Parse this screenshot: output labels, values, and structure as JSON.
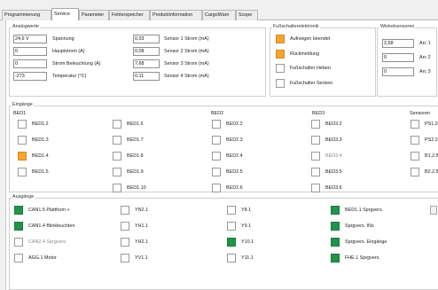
{
  "tabs": [
    "Programmierung",
    "Service",
    "Parameter",
    "Fehlerspeicher",
    "Produktinformation",
    "CargoWarn",
    "Scope"
  ],
  "active_tab": "Service",
  "analogwerte": {
    "title": "Analogwerte",
    "left": [
      {
        "value": "24,6 V",
        "label": "Spannung"
      },
      {
        "value": "0",
        "label": "Hauptstrom (A)"
      },
      {
        "value": "0",
        "label": "Strom Beleuchtung (A)"
      },
      {
        "value": "-273",
        "label": "Temperatur (°C)"
      }
    ],
    "right": [
      {
        "value": "0,03",
        "label": "Sensor 1 Strom (mA)"
      },
      {
        "value": "0,08",
        "label": "Sensor 2 Strom (mA)"
      },
      {
        "value": "7,68",
        "label": "Sensor 3 Strom (mA)"
      },
      {
        "value": "0,11",
        "label": "Sensor 4 Strom (mA)"
      }
    ]
  },
  "fussschalter": {
    "title": "Fußschalterelektronik",
    "items": [
      {
        "label": "Aufneigen beendet",
        "state": "orange"
      },
      {
        "label": "Rückmeldung",
        "state": "orange"
      },
      {
        "label": "Fußschalter Heben",
        "state": "off"
      },
      {
        "label": "Fußschalter Senken",
        "state": "off"
      }
    ]
  },
  "winkelsensoren": {
    "title": "Winkelsensoren",
    "items": [
      {
        "value": "2,58",
        "label": "Arc 1"
      },
      {
        "value": "0",
        "label": "Arc 2"
      },
      {
        "value": "0",
        "label": "Arc 3"
      }
    ]
  },
  "eingaenge": {
    "title": "Eingänge",
    "bed1_title": "BED1",
    "bed2_title": "BED2",
    "bed3_title": "BED3",
    "sensoren_title": "Sensoren",
    "bed1_col1": [
      {
        "label": "BED1.2",
        "state": "off"
      },
      {
        "label": "BED1.3",
        "state": "off"
      },
      {
        "label": "BED1.4",
        "state": "orange"
      },
      {
        "label": "BED1.5",
        "state": "off"
      }
    ],
    "bed1_col2": [
      {
        "label": "BED1.6",
        "state": "off"
      },
      {
        "label": "BED1.7",
        "state": "off"
      },
      {
        "label": "BED1.8",
        "state": "off"
      },
      {
        "label": "BED1.9",
        "state": "off"
      },
      {
        "label": "BED1.10",
        "state": "off"
      }
    ],
    "bed2": [
      {
        "label": "BED2.2",
        "state": "off"
      },
      {
        "label": "BED2.3",
        "state": "off"
      },
      {
        "label": "BED2.4",
        "state": "off"
      },
      {
        "label": "BED2.5",
        "state": "off"
      },
      {
        "label": "BED2.6",
        "state": "off"
      }
    ],
    "bed3": [
      {
        "label": "BED3.2",
        "state": "off",
        "dim": false
      },
      {
        "label": "BED3.3",
        "state": "off",
        "dim": false
      },
      {
        "label": "BED3.4",
        "state": "off",
        "dim": true
      },
      {
        "label": "BED3.5",
        "state": "off",
        "dim": false
      },
      {
        "label": "BED3.6",
        "state": "off",
        "dim": false
      }
    ],
    "sensoren": [
      {
        "label": "PS1.2",
        "state": "off"
      },
      {
        "label": "PS2.2",
        "state": "off"
      },
      {
        "label": "B1.2.5",
        "state": "off"
      },
      {
        "label": "B2.2.5",
        "state": "off"
      }
    ]
  },
  "ausgaenge": {
    "title": "Ausgänge",
    "col1": [
      {
        "label": "CAN1.5 Plattform +",
        "state": "green",
        "dim": false
      },
      {
        "label": "CAN1.4 Blinkleuchten",
        "state": "green",
        "dim": false
      },
      {
        "label": "CAN2.4 Sprgvers.",
        "state": "off",
        "dim": true
      },
      {
        "label": "AGG.1 Motor",
        "state": "off",
        "dim": false
      }
    ],
    "col2": [
      {
        "label": "YN2.1",
        "state": "off"
      },
      {
        "label": "YH1.1",
        "state": "off"
      },
      {
        "label": "YH2.1",
        "state": "off"
      },
      {
        "label": "YV1.1",
        "state": "off"
      }
    ],
    "col3": [
      {
        "label": "Y8.1",
        "state": "off"
      },
      {
        "label": "Y9.1",
        "state": "off"
      },
      {
        "label": "Y10.1",
        "state": "green"
      },
      {
        "label": "Y11.1",
        "state": "off"
      }
    ],
    "col4": [
      {
        "label": "BED1.1 Sprgvers.",
        "state": "green"
      },
      {
        "label": "Sprgvers. INs",
        "state": "green"
      },
      {
        "label": "Sprgvers. Eingänge",
        "state": "green"
      },
      {
        "label": "FHE.1 Sprgvers.",
        "state": "green"
      }
    ]
  }
}
